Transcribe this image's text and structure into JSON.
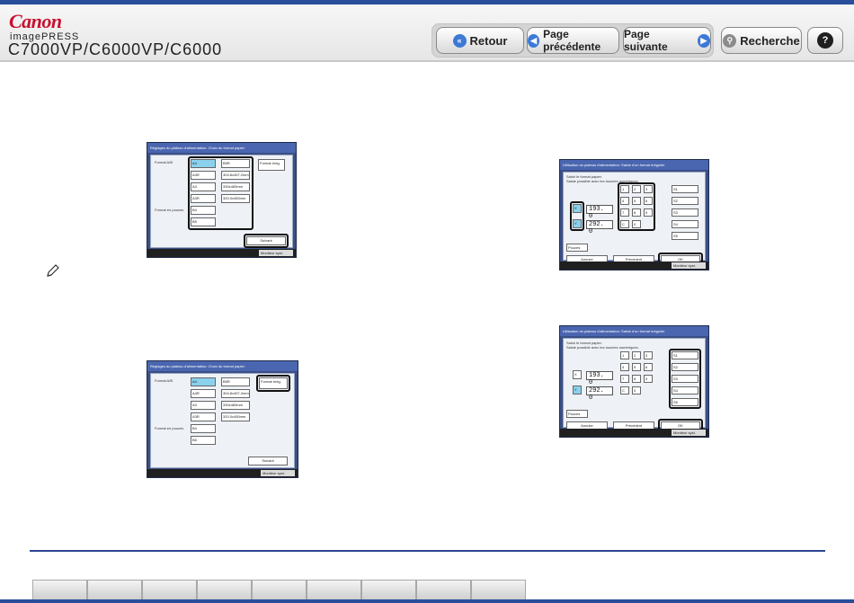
{
  "brand": {
    "logo": "Canon",
    "product_line": "imagePRESS",
    "model": "C7000VP/C6000VP/C6000"
  },
  "toolbar": {
    "back_label": "Retour",
    "prev_label": "Page précédente",
    "next_label": "Page suivante",
    "search_label": "Recherche",
    "help_icon": "question-icon"
  },
  "colors": {
    "accent": "#2a4d9c",
    "nav_icon": "#3d79d6",
    "screen_frame": "#3b4f86",
    "selected_key": "#8bd1ee"
  },
  "screens": {
    "paper_select": {
      "title": "Réglages du plateau d'alimentation: Choix du format papier",
      "format_label": "Format A/B",
      "sizes": [
        "A4",
        "A4R",
        "A3",
        "A3R",
        "B4",
        "B5"
      ],
      "custom_sizes": [
        "B5R",
        "304.8x457.2mm",
        "330x483mm",
        "320.0x450mm"
      ],
      "irregular_label": "Format irrég.",
      "envelope_label": "Format en pouces",
      "next_button": "Suivant",
      "monitor": "Moniteur syst."
    },
    "irregular_entry": {
      "title": "Utilisation du plateau d'alimentation: Saisie d'un format irrégulier",
      "instruction_1": "Saisir le format papier.",
      "instruction_2": "Saisie possible avec les touches numériques.",
      "x_value": "193. 0",
      "y_value": "292. 0",
      "unit": "mm",
      "keypad": [
        "1",
        "2",
        "3",
        "4",
        "5",
        "6",
        "7",
        "8",
        "9",
        "C",
        "0"
      ],
      "memory": [
        "S1",
        "S2",
        "S3",
        "S4",
        "S5"
      ],
      "cancel_button": "Annuler",
      "previous_button": "Précédent",
      "ok_button": "OK",
      "inch_label": "Pouces",
      "memory_label": "Mémor. form.",
      "monitor": "Moniteur syst."
    }
  }
}
